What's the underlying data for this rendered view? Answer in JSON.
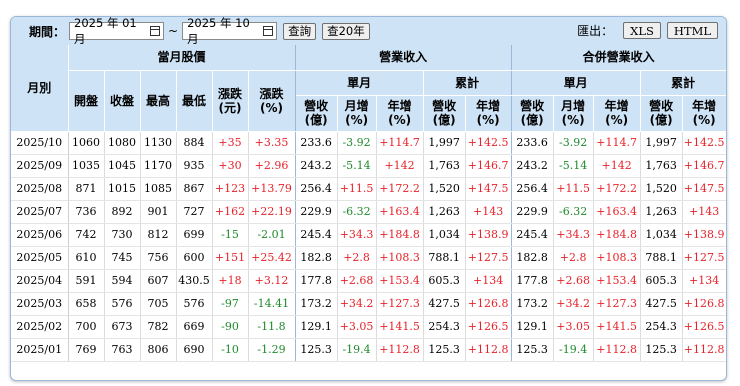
{
  "toolbar": {
    "period_label": "期間：",
    "start_date": "2025 年 01 月",
    "tilde": "~",
    "end_date": "2025 年 10 月",
    "query_button": "查詢",
    "query20_button": "查20年",
    "export_label": "匯出：",
    "xls_button": "XLS",
    "html_button": "HTML"
  },
  "headers": {
    "month": "月別",
    "stock_group": "當月股價",
    "revenue_group": "營業收入",
    "consolidated_group": "合併營業收入",
    "single_month": "單月",
    "cumulative": "累計",
    "open": "開盤",
    "close": "收盤",
    "high": "最高",
    "low": "最低",
    "chg_line1": "漲跌",
    "chg_line2": "(元)",
    "chgpct_line1": "漲跌",
    "chgpct_line2": "(%)",
    "rev_line1": "營收",
    "rev_line2": "(億)",
    "mom_line1": "月增",
    "mom_line2": "(%)",
    "yoy_line1": "年增",
    "yoy_line2": "(%)"
  },
  "rows": [
    {
      "month": "2025/10",
      "open": "1060",
      "close": "1080",
      "high": "1130",
      "low": "884",
      "chg": "+35",
      "chgpct": "+3.35",
      "rev": "233.6",
      "mom": "-3.92",
      "yoy": "+114.7",
      "cum": "1,997",
      "cumyoy": "+142.5",
      "crev": "233.6",
      "cmom": "-3.92",
      "cyoy": "+114.7",
      "ccum": "1,997",
      "ccumyoy": "+142.5"
    },
    {
      "month": "2025/09",
      "open": "1035",
      "close": "1045",
      "high": "1170",
      "low": "935",
      "chg": "+30",
      "chgpct": "+2.96",
      "rev": "243.2",
      "mom": "-5.14",
      "yoy": "+142",
      "cum": "1,763",
      "cumyoy": "+146.7",
      "crev": "243.2",
      "cmom": "-5.14",
      "cyoy": "+142",
      "ccum": "1,763",
      "ccumyoy": "+146.7"
    },
    {
      "month": "2025/08",
      "open": "871",
      "close": "1015",
      "high": "1085",
      "low": "867",
      "chg": "+123",
      "chgpct": "+13.79",
      "rev": "256.4",
      "mom": "+11.5",
      "yoy": "+172.2",
      "cum": "1,520",
      "cumyoy": "+147.5",
      "crev": "256.4",
      "cmom": "+11.5",
      "cyoy": "+172.2",
      "ccum": "1,520",
      "ccumyoy": "+147.5"
    },
    {
      "month": "2025/07",
      "open": "736",
      "close": "892",
      "high": "901",
      "low": "727",
      "chg": "+162",
      "chgpct": "+22.19",
      "rev": "229.9",
      "mom": "-6.32",
      "yoy": "+163.4",
      "cum": "1,263",
      "cumyoy": "+143",
      "crev": "229.9",
      "cmom": "-6.32",
      "cyoy": "+163.4",
      "ccum": "1,263",
      "ccumyoy": "+143"
    },
    {
      "month": "2025/06",
      "open": "742",
      "close": "730",
      "high": "812",
      "low": "699",
      "chg": "-15",
      "chgpct": "-2.01",
      "rev": "245.4",
      "mom": "+34.3",
      "yoy": "+184.8",
      "cum": "1,034",
      "cumyoy": "+138.9",
      "crev": "245.4",
      "cmom": "+34.3",
      "cyoy": "+184.8",
      "ccum": "1,034",
      "ccumyoy": "+138.9"
    },
    {
      "month": "2025/05",
      "open": "610",
      "close": "745",
      "high": "756",
      "low": "600",
      "chg": "+151",
      "chgpct": "+25.42",
      "rev": "182.8",
      "mom": "+2.8",
      "yoy": "+108.3",
      "cum": "788.1",
      "cumyoy": "+127.5",
      "crev": "182.8",
      "cmom": "+2.8",
      "cyoy": "+108.3",
      "ccum": "788.1",
      "ccumyoy": "+127.5"
    },
    {
      "month": "2025/04",
      "open": "591",
      "close": "594",
      "high": "607",
      "low": "430.5",
      "chg": "+18",
      "chgpct": "+3.12",
      "rev": "177.8",
      "mom": "+2.68",
      "yoy": "+153.4",
      "cum": "605.3",
      "cumyoy": "+134",
      "crev": "177.8",
      "cmom": "+2.68",
      "cyoy": "+153.4",
      "ccum": "605.3",
      "ccumyoy": "+134"
    },
    {
      "month": "2025/03",
      "open": "658",
      "close": "576",
      "high": "705",
      "low": "576",
      "chg": "-97",
      "chgpct": "-14.41",
      "rev": "173.2",
      "mom": "+34.2",
      "yoy": "+127.3",
      "cum": "427.5",
      "cumyoy": "+126.8",
      "crev": "173.2",
      "cmom": "+34.2",
      "cyoy": "+127.3",
      "ccum": "427.5",
      "ccumyoy": "+126.8"
    },
    {
      "month": "2025/02",
      "open": "700",
      "close": "673",
      "high": "782",
      "low": "669",
      "chg": "-90",
      "chgpct": "-11.8",
      "rev": "129.1",
      "mom": "+3.05",
      "yoy": "+141.5",
      "cum": "254.3",
      "cumyoy": "+126.5",
      "crev": "129.1",
      "cmom": "+3.05",
      "cyoy": "+141.5",
      "ccum": "254.3",
      "ccumyoy": "+126.5"
    },
    {
      "month": "2025/01",
      "open": "769",
      "close": "763",
      "high": "806",
      "low": "690",
      "chg": "-10",
      "chgpct": "-1.29",
      "rev": "125.3",
      "mom": "-19.4",
      "yoy": "+112.8",
      "cum": "125.3",
      "cumyoy": "+112.8",
      "crev": "125.3",
      "cmom": "-19.4",
      "cyoy": "+112.8",
      "ccum": "125.3",
      "ccumyoy": "+112.8"
    }
  ],
  "colors": {
    "up": "#e8222a",
    "down": "#1f8a2c",
    "header_bg": "#cfe3f6"
  }
}
